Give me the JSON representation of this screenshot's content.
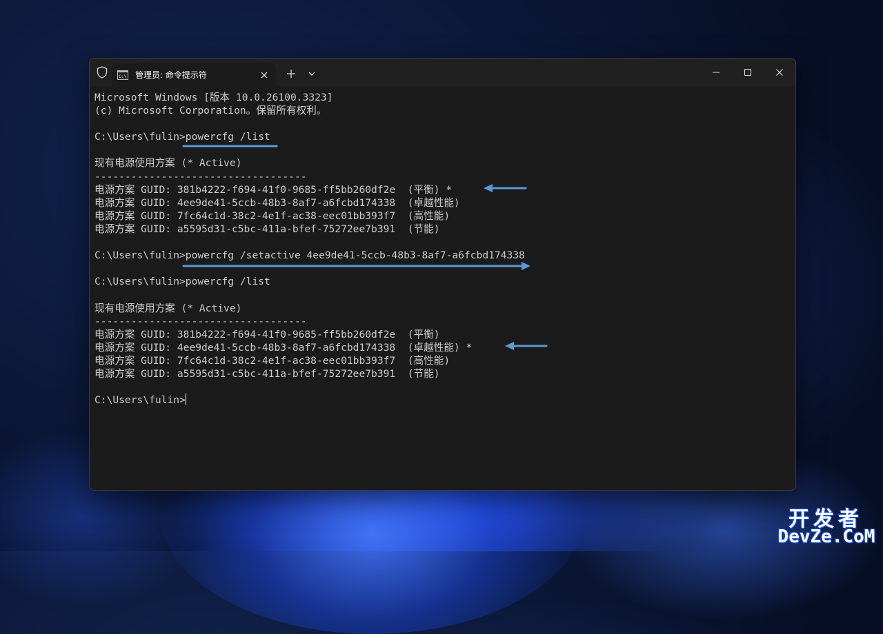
{
  "window": {
    "tab_title": "管理员: 命令提示符"
  },
  "icons": {
    "shield": "shield-icon",
    "tab": "cmd-icon",
    "tab_close": "close-icon",
    "new_tab": "plus-icon",
    "dropdown": "chevron-down-icon",
    "minimize": "minimize-icon",
    "maximize": "maximize-icon",
    "close": "close-icon"
  },
  "console": {
    "lines": [
      "Microsoft Windows [版本 10.0.26100.3323]",
      "(c) Microsoft Corporation。保留所有权利。",
      "",
      "C:\\Users\\fulin>powercfg /list",
      "",
      "现有电源使用方案 (* Active)",
      "-----------------------------------",
      "电源方案 GUID: 381b4222-f694-41f0-9685-ff5bb260df2e  (平衡) *",
      "电源方案 GUID: 4ee9de41-5ccb-48b3-8af7-a6fcbd174338  (卓越性能)",
      "电源方案 GUID: 7fc64c1d-38c2-4e1f-ac38-eec01bb393f7  (高性能)",
      "电源方案 GUID: a5595d31-c5bc-411a-bfef-75272ee7b391  (节能)",
      "",
      "C:\\Users\\fulin>powercfg /setactive 4ee9de41-5ccb-48b3-8af7-a6fcbd174338",
      "",
      "C:\\Users\\fulin>powercfg /list",
      "",
      "现有电源使用方案 (* Active)",
      "-----------------------------------",
      "电源方案 GUID: 381b4222-f694-41f0-9685-ff5bb260df2e  (平衡)",
      "电源方案 GUID: 4ee9de41-5ccb-48b3-8af7-a6fcbd174338  (卓越性能) *",
      "电源方案 GUID: 7fc64c1d-38c2-4e1f-ac38-eec01bb393f7  (高性能)",
      "电源方案 GUID: a5595d31-c5bc-411a-bfef-75272ee7b391  (节能)",
      "",
      "C:\\Users\\fulin>"
    ]
  },
  "colors": {
    "console_text": "#cccccc",
    "annotation": "#5b9bd5",
    "window_bg": "#1b1b1b",
    "titlebar_bg": "#202020"
  },
  "watermark": {
    "cn": "开发者",
    "en": "DevZe.CoM"
  }
}
